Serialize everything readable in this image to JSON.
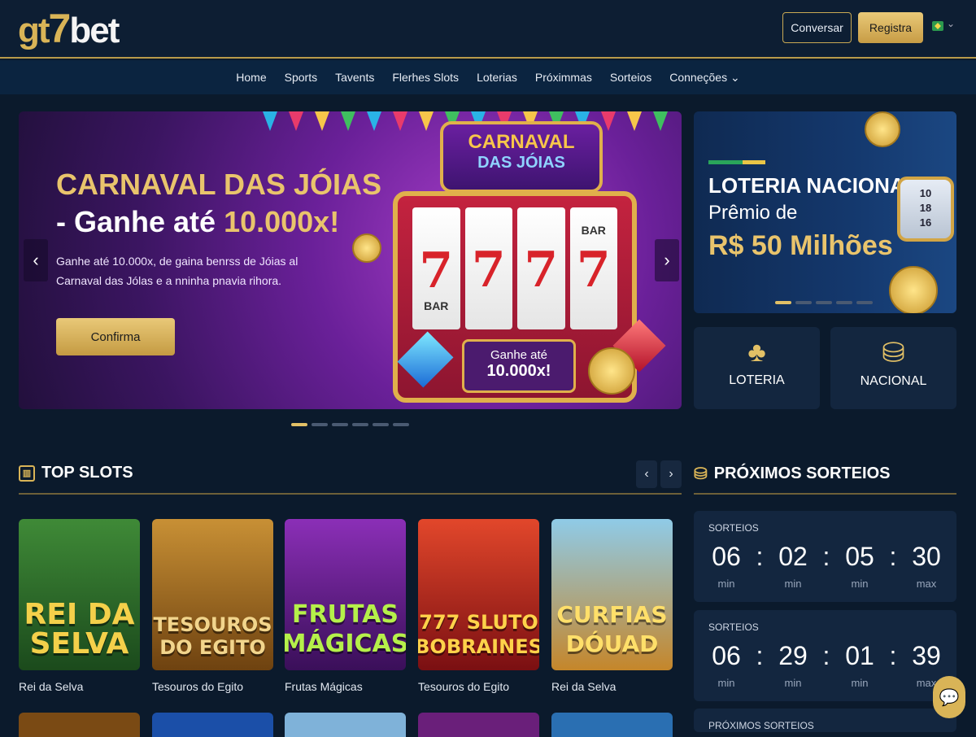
{
  "header": {
    "logo": "gt7bet",
    "logo_parts": [
      "gt",
      "7",
      "bet"
    ],
    "converse_label": "Conversar",
    "register_label": "Registra",
    "language_icon": "brazil-flag-icon"
  },
  "nav": {
    "items": [
      "Home",
      "Sports",
      "Tavents",
      "Flerhes Slots",
      "Loterias",
      "Próximmas",
      "Sorteios",
      "Conneções"
    ]
  },
  "hero": {
    "title_line1": "CARNAVAL DAS JÓIAS",
    "title_line2_prefix": "- Ganhe até ",
    "title_line2_highlight": "10.000x!",
    "description": "Ganhe até 10.000x, de gaina benrss de Jóias al Carnaval das Jólas e a nninha pnavia rihora.",
    "cta_label": "Confirma",
    "marquee_line1": "CARNAVAL",
    "marquee_line2": "DAS JÓIAS",
    "reel_top": [
      "",
      "",
      "",
      "BAR"
    ],
    "reel_mid": [
      "7",
      "7",
      "7",
      "7"
    ],
    "reel_bot": [
      "BAR",
      "",
      "",
      ""
    ],
    "prize_text": "Ganhe até",
    "prize_value": "10.000x!",
    "slides": 6,
    "active_slide": 0
  },
  "lottery_banner": {
    "line1": "LOTERIA NACIONAL -",
    "line2": "Prêmio de",
    "line3": "R$ 50 Milhões",
    "drum_numbers": [
      "10",
      "18",
      "16"
    ],
    "slides": 5,
    "active_slide": 0
  },
  "tiles": [
    {
      "label": "LOTERIA",
      "icon": "clover-icon"
    },
    {
      "label": "NACIONAL",
      "icon": "coins-icon"
    }
  ],
  "top_slots": {
    "title": "TOP SLOTS",
    "games": [
      {
        "art": "REI DA SELVA",
        "caption": "Rei da Selva",
        "bg": "#2f6b2a",
        "color": "#f4d04a"
      },
      {
        "art": "TESOUROS DO EGITO",
        "caption": "Tesouros do Egito",
        "bg": "#8a5a12",
        "color": "#f2d58c"
      },
      {
        "art": "FRUTAS MÁGICAS",
        "caption": "Frutas Mágicas",
        "bg": "#5b1d7e",
        "color": "#b5f04a"
      },
      {
        "art": "777 SLUTO BOBRAINES",
        "caption": "Tesouros do Egito",
        "bg": "#a11f1f",
        "color": "#ffd24a"
      },
      {
        "art": "CURFIAS DÓUAD",
        "caption": "Rei da Selva",
        "bg": "#b97a2a",
        "color": "#ffdf6a"
      }
    ]
  },
  "draws": {
    "title": "PRÓXIMOS SORTEIOS",
    "items": [
      {
        "label": "SORTEIOS",
        "values": [
          "06",
          "02",
          "05",
          "30"
        ],
        "units": [
          "min",
          "min",
          "min",
          "max"
        ]
      },
      {
        "label": "SORTEIOS",
        "values": [
          "06",
          "29",
          "01",
          "39"
        ],
        "units": [
          "min",
          "min",
          "min",
          "max"
        ]
      }
    ],
    "next_label": "PRÓXIMOS SORTEIOS"
  },
  "colors": {
    "gold": "#d9b457",
    "bg": "#0b1a2c",
    "panel": "#13263f"
  }
}
